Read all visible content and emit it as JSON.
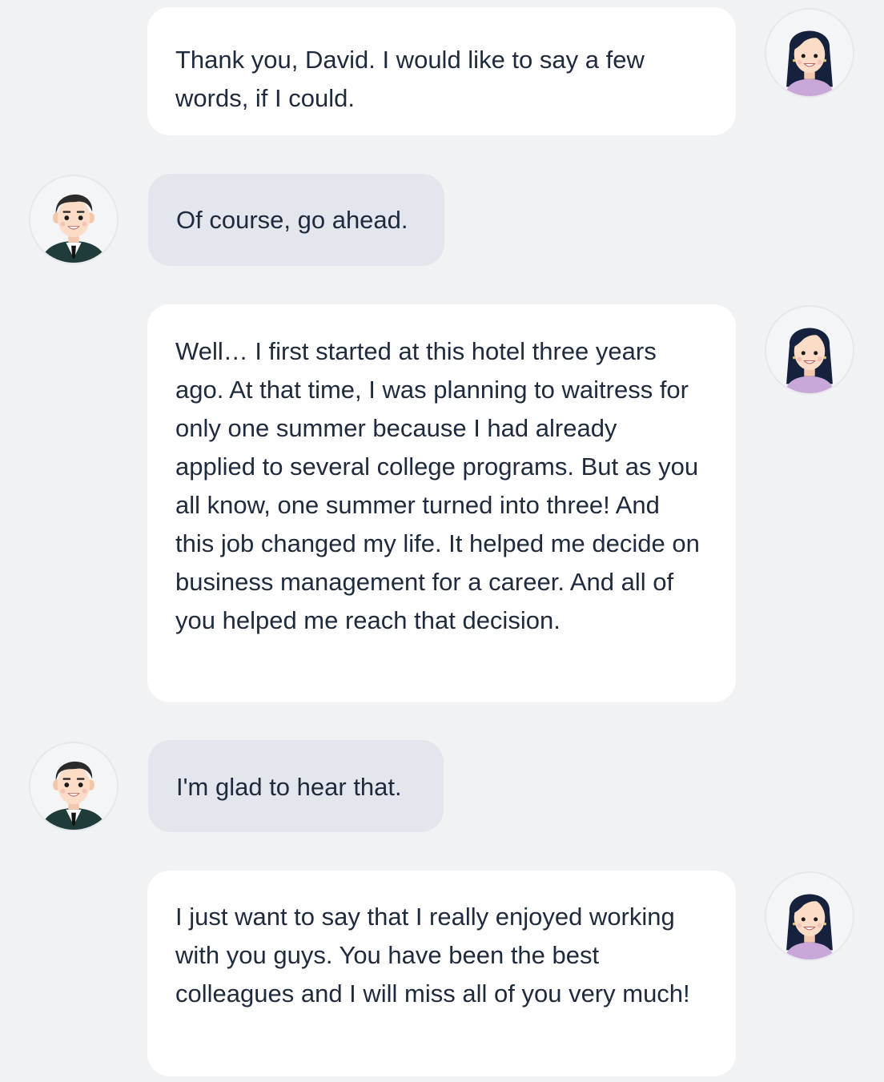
{
  "conversation": {
    "messages": [
      {
        "speaker": "woman",
        "text": "Thank you, David. I would like to say a few words, if I could."
      },
      {
        "speaker": "man",
        "text": "Of course, go ahead."
      },
      {
        "speaker": "woman",
        "text": "Well… I first started at this hotel three years ago. At that time, I was planning to waitress for only one summer because I had already applied to several college programs. But as you all know, one summer turned into three! And this job changed my life. It helped me decide on business management for a career. And all of you helped me reach that decision."
      },
      {
        "speaker": "man",
        "text": "I'm glad to hear that."
      },
      {
        "speaker": "woman",
        "text": "I just want to say that I really enjoyed working with you guys. You have been the best colleagues and I will miss all of you very much!"
      }
    ]
  },
  "avatars": {
    "woman": {
      "icon": "woman-avatar-icon"
    },
    "man": {
      "icon": "man-avatar-icon"
    }
  },
  "colors": {
    "background": "#f1f2f4",
    "bubble_right": "#ffffff",
    "bubble_left": "#e3e6ec",
    "text": "#1f2a3c"
  }
}
